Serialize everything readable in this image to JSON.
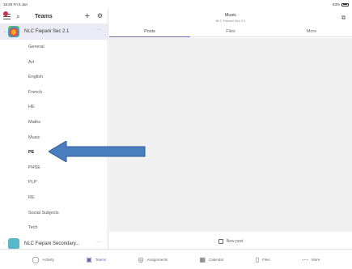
{
  "status_bar": {
    "time": "18:20 Fri 6 Jan",
    "battery": "63%"
  },
  "left_pane": {
    "title": "Teams",
    "icons": {
      "menu": "hamburger-icon",
      "search": "search-icon",
      "add": "plus-icon",
      "settings": "gear-icon"
    },
    "team1": {
      "name": "NLC Fiepani Sec 2.1",
      "more": "···"
    },
    "channels": [
      "General",
      "Art",
      "English",
      "French",
      "HE",
      "Maths",
      "Music",
      "PE",
      "PHSE",
      "PLP",
      "RE",
      "Social Subjects",
      "Tech"
    ],
    "team2": {
      "name": "NLC Fiepani Secondary...",
      "more": "···"
    }
  },
  "channel_header": {
    "title": "Music",
    "subtitle": "NLC Fiepani Sec 2.1"
  },
  "tabs": [
    "Posts",
    "Files",
    "More"
  ],
  "new_post": "New post",
  "bottom_nav": [
    "Activity",
    "Teams",
    "Assignments",
    "Calendar",
    "Files",
    "More"
  ],
  "colors": {
    "accent": "#6264a7",
    "arrow": "#4a7ebf",
    "feed_bg": "#f0f0f0"
  }
}
